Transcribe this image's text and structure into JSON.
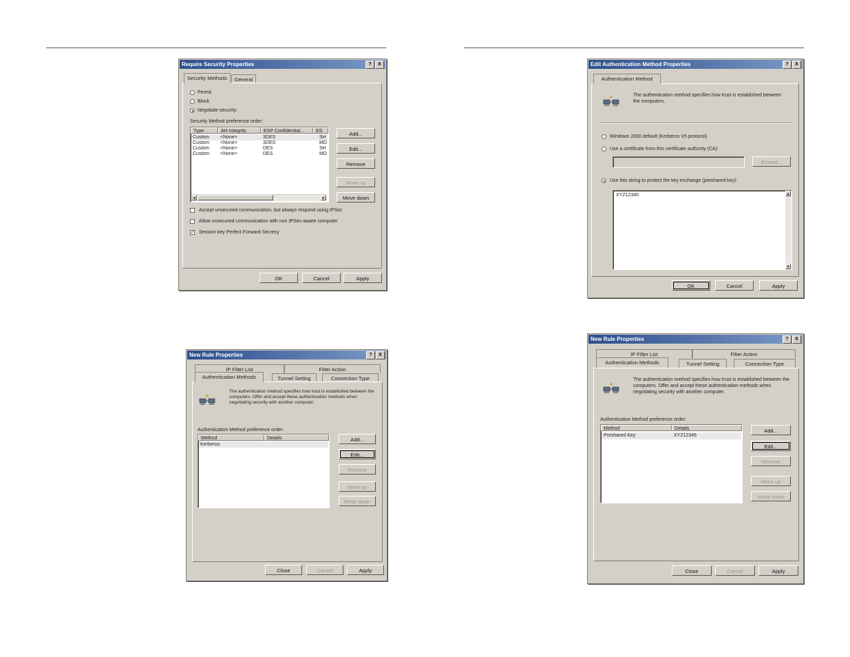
{
  "dialog1": {
    "title": "Require Security Properties",
    "tabs": [
      "Security Methods",
      "General"
    ],
    "radios": [
      "Permit",
      "Block",
      "Negotiate security:"
    ],
    "selected_radio": "Negotiate security:",
    "list_label": "Security Method preference order:",
    "columns": [
      "Type",
      "AH Integrity",
      "ESP Confidential...",
      "ES"
    ],
    "rows": [
      [
        "Custom",
        "<None>",
        "3DES",
        "SH"
      ],
      [
        "Custom",
        "<None>",
        "3DES",
        "MD"
      ],
      [
        "Custom",
        "<None>",
        "DES",
        "SH"
      ],
      [
        "Custom",
        "<None>",
        "DES",
        "MD"
      ]
    ],
    "side_buttons": [
      "Add...",
      "Edit...",
      "Remove",
      "Move up",
      "Move down"
    ],
    "checkboxes": [
      {
        "label": "Accept unsecured communication, but always respond using IPSec",
        "checked": false
      },
      {
        "label": "Allow unsecured communication with non IPSec-aware computer",
        "checked": false
      },
      {
        "label": "Session key Perfect Forward Secrecy",
        "checked": true
      }
    ],
    "footer_buttons": [
      "OK",
      "Cancel",
      "Apply"
    ]
  },
  "dialog2": {
    "title": "Edit Authentication Method Properties",
    "tab": "Authentication Method",
    "description": "The authentication method specifies how trust is established between the computers.",
    "options": [
      "Windows 2000 default (Kerberos V5 protocol)",
      "Use a certificate from this certificate authority (CA):",
      "Use this string to protect the key exchange (preshared key):"
    ],
    "browse_label": "Browse...",
    "preshared_key": "XYZ12345",
    "footer_buttons": [
      "OK",
      "Cancel",
      "Apply"
    ]
  },
  "dialog3": {
    "title": "New Rule Properties",
    "tabs_back": [
      "IP Filter List",
      "Filter Action"
    ],
    "tabs_front": [
      "Authentication Methods",
      "Tunnel Setting",
      "Connection Type"
    ],
    "description": "The authentication method specifies how trust is established between the computers. Offer and accept these authentication methods when negotiating security with another computer.",
    "list_label": "Authentication Method preference order:",
    "columns": [
      "Method",
      "Details"
    ],
    "rows": [
      [
        "Kerberos",
        ""
      ]
    ],
    "side_buttons": [
      "Add...",
      "Edit...",
      "Remove",
      "Move up",
      "Move down"
    ],
    "footer_buttons": [
      "Close",
      "Cancel",
      "Apply"
    ]
  },
  "dialog4": {
    "title": "New Rule Properties",
    "tabs_back": [
      "IP Filter List",
      "Filter Action"
    ],
    "tabs_front": [
      "Authentication Methods",
      "Tunnel Setting",
      "Connection Type"
    ],
    "description": "The authentication method specifies how trust is established between the computers. Offer and accept these authentication methods when negotiating security with another computer.",
    "list_label": "Authentication Method preference order:",
    "columns": [
      "Method",
      "Details"
    ],
    "rows": [
      [
        "Preshared Key",
        "XYZ12345"
      ]
    ],
    "side_buttons": [
      "Add...",
      "Edit...",
      "Remove",
      "Move up",
      "Move down"
    ],
    "footer_buttons": [
      "Close",
      "Cancel",
      "Apply"
    ]
  },
  "title_buttons": [
    "?",
    "X"
  ]
}
